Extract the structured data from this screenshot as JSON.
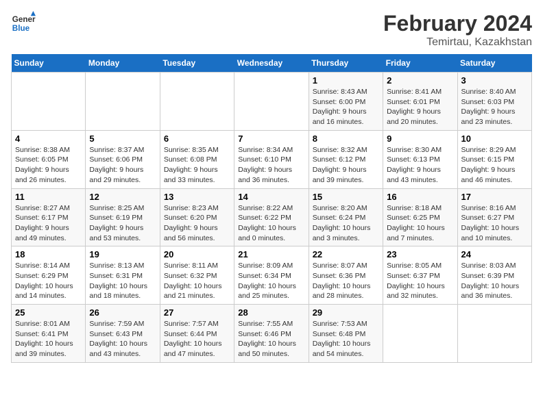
{
  "header": {
    "logo_line1": "General",
    "logo_line2": "Blue",
    "title": "February 2024",
    "subtitle": "Temirtau, Kazakhstan"
  },
  "weekdays": [
    "Sunday",
    "Monday",
    "Tuesday",
    "Wednesday",
    "Thursday",
    "Friday",
    "Saturday"
  ],
  "weeks": [
    [
      {
        "day": "",
        "info": ""
      },
      {
        "day": "",
        "info": ""
      },
      {
        "day": "",
        "info": ""
      },
      {
        "day": "",
        "info": ""
      },
      {
        "day": "1",
        "info": "Sunrise: 8:43 AM\nSunset: 6:00 PM\nDaylight: 9 hours\nand 16 minutes."
      },
      {
        "day": "2",
        "info": "Sunrise: 8:41 AM\nSunset: 6:01 PM\nDaylight: 9 hours\nand 20 minutes."
      },
      {
        "day": "3",
        "info": "Sunrise: 8:40 AM\nSunset: 6:03 PM\nDaylight: 9 hours\nand 23 minutes."
      }
    ],
    [
      {
        "day": "4",
        "info": "Sunrise: 8:38 AM\nSunset: 6:05 PM\nDaylight: 9 hours\nand 26 minutes."
      },
      {
        "day": "5",
        "info": "Sunrise: 8:37 AM\nSunset: 6:06 PM\nDaylight: 9 hours\nand 29 minutes."
      },
      {
        "day": "6",
        "info": "Sunrise: 8:35 AM\nSunset: 6:08 PM\nDaylight: 9 hours\nand 33 minutes."
      },
      {
        "day": "7",
        "info": "Sunrise: 8:34 AM\nSunset: 6:10 PM\nDaylight: 9 hours\nand 36 minutes."
      },
      {
        "day": "8",
        "info": "Sunrise: 8:32 AM\nSunset: 6:12 PM\nDaylight: 9 hours\nand 39 minutes."
      },
      {
        "day": "9",
        "info": "Sunrise: 8:30 AM\nSunset: 6:13 PM\nDaylight: 9 hours\nand 43 minutes."
      },
      {
        "day": "10",
        "info": "Sunrise: 8:29 AM\nSunset: 6:15 PM\nDaylight: 9 hours\nand 46 minutes."
      }
    ],
    [
      {
        "day": "11",
        "info": "Sunrise: 8:27 AM\nSunset: 6:17 PM\nDaylight: 9 hours\nand 49 minutes."
      },
      {
        "day": "12",
        "info": "Sunrise: 8:25 AM\nSunset: 6:19 PM\nDaylight: 9 hours\nand 53 minutes."
      },
      {
        "day": "13",
        "info": "Sunrise: 8:23 AM\nSunset: 6:20 PM\nDaylight: 9 hours\nand 56 minutes."
      },
      {
        "day": "14",
        "info": "Sunrise: 8:22 AM\nSunset: 6:22 PM\nDaylight: 10 hours\nand 0 minutes."
      },
      {
        "day": "15",
        "info": "Sunrise: 8:20 AM\nSunset: 6:24 PM\nDaylight: 10 hours\nand 3 minutes."
      },
      {
        "day": "16",
        "info": "Sunrise: 8:18 AM\nSunset: 6:25 PM\nDaylight: 10 hours\nand 7 minutes."
      },
      {
        "day": "17",
        "info": "Sunrise: 8:16 AM\nSunset: 6:27 PM\nDaylight: 10 hours\nand 10 minutes."
      }
    ],
    [
      {
        "day": "18",
        "info": "Sunrise: 8:14 AM\nSunset: 6:29 PM\nDaylight: 10 hours\nand 14 minutes."
      },
      {
        "day": "19",
        "info": "Sunrise: 8:13 AM\nSunset: 6:31 PM\nDaylight: 10 hours\nand 18 minutes."
      },
      {
        "day": "20",
        "info": "Sunrise: 8:11 AM\nSunset: 6:32 PM\nDaylight: 10 hours\nand 21 minutes."
      },
      {
        "day": "21",
        "info": "Sunrise: 8:09 AM\nSunset: 6:34 PM\nDaylight: 10 hours\nand 25 minutes."
      },
      {
        "day": "22",
        "info": "Sunrise: 8:07 AM\nSunset: 6:36 PM\nDaylight: 10 hours\nand 28 minutes."
      },
      {
        "day": "23",
        "info": "Sunrise: 8:05 AM\nSunset: 6:37 PM\nDaylight: 10 hours\nand 32 minutes."
      },
      {
        "day": "24",
        "info": "Sunrise: 8:03 AM\nSunset: 6:39 PM\nDaylight: 10 hours\nand 36 minutes."
      }
    ],
    [
      {
        "day": "25",
        "info": "Sunrise: 8:01 AM\nSunset: 6:41 PM\nDaylight: 10 hours\nand 39 minutes."
      },
      {
        "day": "26",
        "info": "Sunrise: 7:59 AM\nSunset: 6:43 PM\nDaylight: 10 hours\nand 43 minutes."
      },
      {
        "day": "27",
        "info": "Sunrise: 7:57 AM\nSunset: 6:44 PM\nDaylight: 10 hours\nand 47 minutes."
      },
      {
        "day": "28",
        "info": "Sunrise: 7:55 AM\nSunset: 6:46 PM\nDaylight: 10 hours\nand 50 minutes."
      },
      {
        "day": "29",
        "info": "Sunrise: 7:53 AM\nSunset: 6:48 PM\nDaylight: 10 hours\nand 54 minutes."
      },
      {
        "day": "",
        "info": ""
      },
      {
        "day": "",
        "info": ""
      }
    ]
  ]
}
